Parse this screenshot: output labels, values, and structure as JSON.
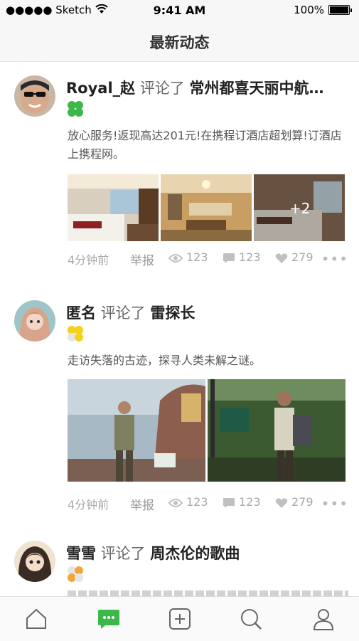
{
  "status_bar": {
    "carrier": "●●●●● Sketch",
    "time": "9:41 AM",
    "battery": "100%",
    "icons": [
      "wifi-icon",
      "battery-icon"
    ]
  },
  "header": {
    "title": "最新动态"
  },
  "posts": [
    {
      "user": "Royal_赵",
      "action": "评论了",
      "target": "常州都喜天丽中航…",
      "text": "放心服务!返现高达201元!在携程订酒店超划算!订酒店上携程网。",
      "photos": [
        "hotel-room-photo",
        "hotel-lobby-photo",
        "hotel-bedroom-photo"
      ],
      "more_photos": "+2",
      "time": "4分钟前",
      "report": "举报",
      "views": "123",
      "comments": "123",
      "likes": "279",
      "badge_color": "#3cb84a"
    },
    {
      "user": "匿名",
      "action": "评论了",
      "target": "雷探长",
      "text": "走访失落的古迹，探寻人类未解之谜。",
      "photos": [
        "explorer-ruins-photo",
        "explorer-forest-photo"
      ],
      "time": "4分钟前",
      "report": "举报",
      "views": "123",
      "comments": "123",
      "likes": "279",
      "badge_color": "#f2d21b"
    },
    {
      "user": "雪雪",
      "action": "评论了",
      "target": "周杰伦的歌曲",
      "badge_color": "#f3a73b"
    }
  ],
  "tabbar": {
    "items": [
      "home-icon",
      "messages-icon",
      "add-icon",
      "search-icon",
      "profile-icon"
    ],
    "active_color": "#3cb84a",
    "inactive_color": "#666666"
  }
}
